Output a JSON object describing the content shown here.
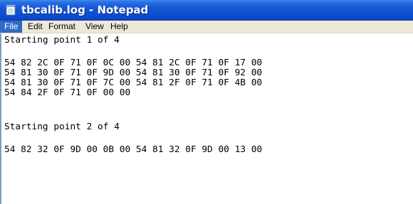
{
  "window": {
    "title": "tbcalib.log - Notepad",
    "icon": "notepad-icon",
    "titlebar_color": "#0d4fcf"
  },
  "menu": {
    "items": [
      {
        "label": "File",
        "active": true
      },
      {
        "label": "Edit"
      },
      {
        "label": "Format"
      },
      {
        "label": "View"
      },
      {
        "label": "Help"
      }
    ],
    "highlight_color": "#316ac5"
  },
  "editor": {
    "lines": [
      "Starting point 1 of 4",
      "",
      "54 82 2C 0F 71 0F 0C 00 54 81 2C 0F 71 0F 17 00",
      "54 81 30 0F 71 0F 9D 00 54 81 30 0F 71 0F 92 00",
      "54 81 30 0F 71 0F 7C 00 54 81 2F 0F 71 0F 4B 00",
      "54 84 2F 0F 71 0F 00 00",
      "",
      "Starting point 2 of 4",
      "",
      "54 82 32 0F 9D 00 0B 00 54 81 32 0F 9D 00 13 00"
    ]
  }
}
